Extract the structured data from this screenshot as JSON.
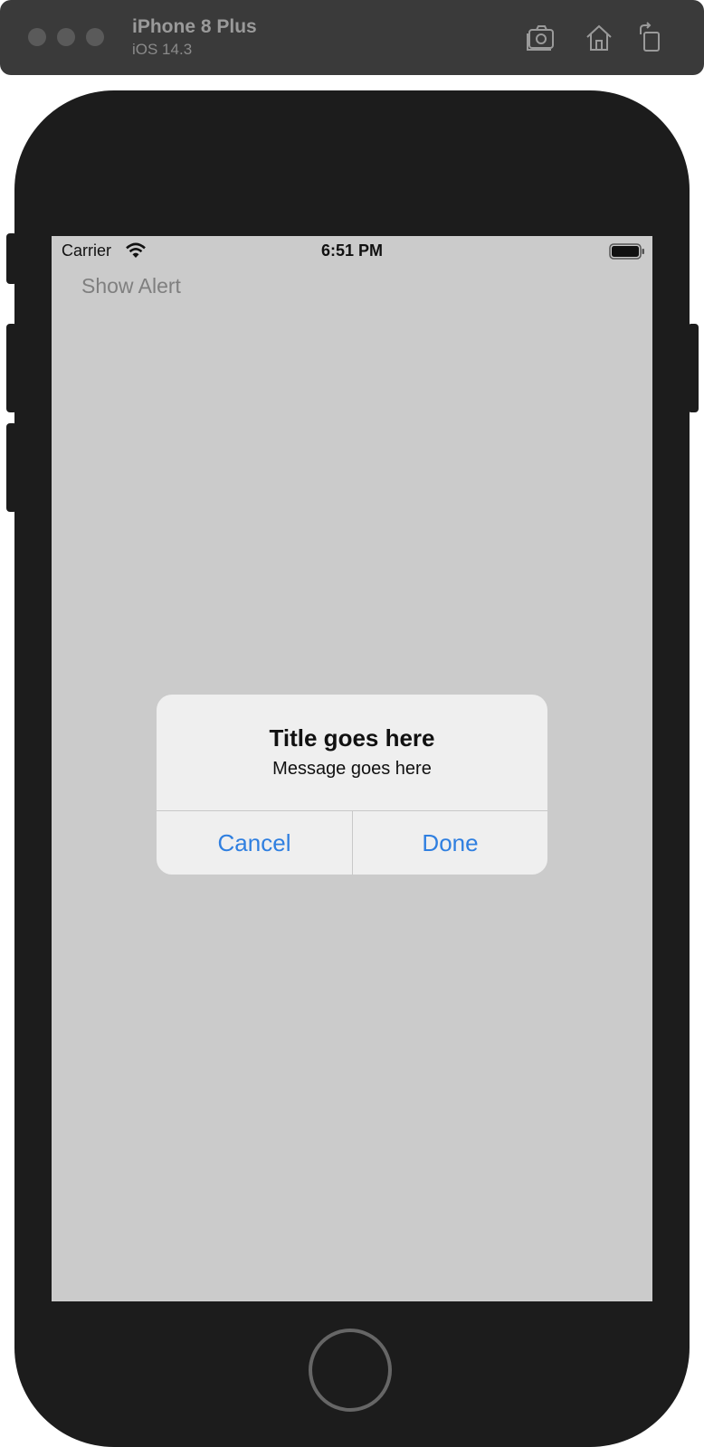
{
  "simulator": {
    "device_name": "iPhone 8 Plus",
    "os_version": "iOS 14.3",
    "icons": [
      "screenshot-icon",
      "home-icon",
      "rotate-icon"
    ]
  },
  "status_bar": {
    "carrier": "Carrier",
    "time": "6:51 PM",
    "icons": [
      "wifi-icon",
      "battery-icon"
    ]
  },
  "app": {
    "show_alert_label": "Show Alert"
  },
  "alert": {
    "title": "Title goes here",
    "message": "Message goes here",
    "cancel_label": "Cancel",
    "done_label": "Done",
    "button_color": "#2f7fe0"
  },
  "colors": {
    "screen_background": "#cbcbcb",
    "alert_background": "#efefef",
    "device_body": "#1c1c1c"
  }
}
